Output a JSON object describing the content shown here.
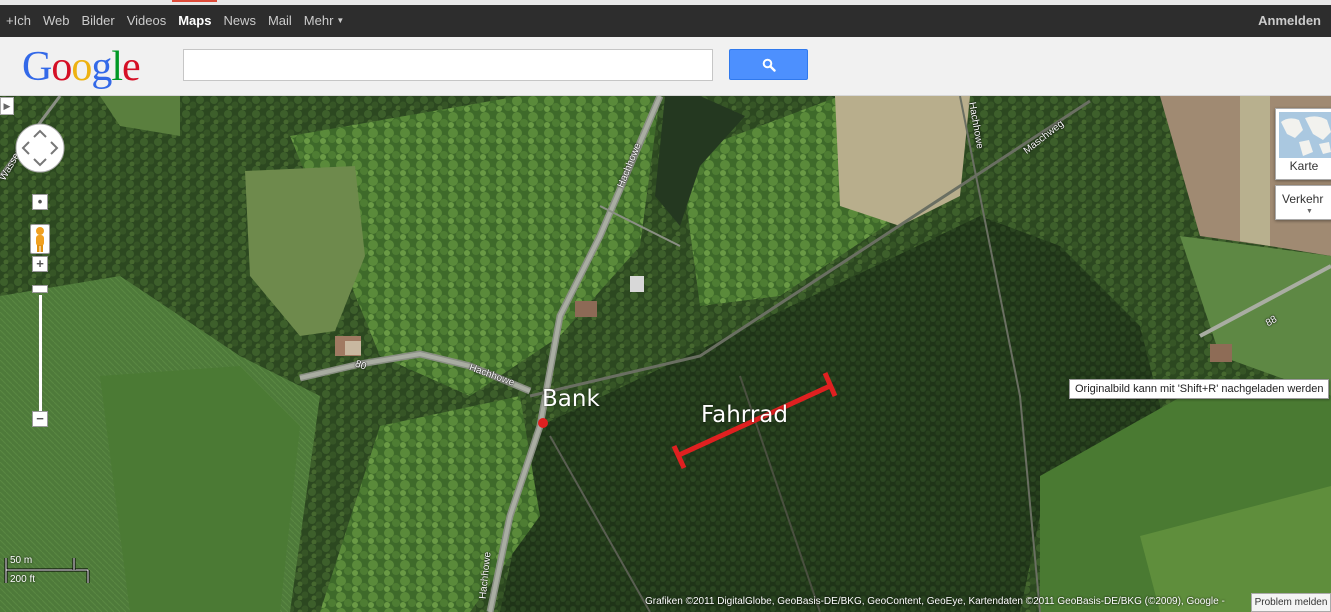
{
  "gbar": {
    "links": [
      "+Ich",
      "Web",
      "Bilder",
      "Videos",
      "Maps",
      "News",
      "Mail",
      "Mehr"
    ],
    "active": "Maps",
    "signin": "Anmelden"
  },
  "logo": {
    "letters": [
      "G",
      "o",
      "o",
      "g",
      "l",
      "e"
    ],
    "colors": [
      "#3369e8",
      "#d50f25",
      "#eeb211",
      "#3369e8",
      "#009925",
      "#d50f25"
    ]
  },
  "search": {
    "value": "",
    "placeholder": ""
  },
  "map_types": {
    "map_label": "Karte",
    "traffic_label": "Verkehr"
  },
  "tooltip": "Originalbild kann mit 'Shift+R' nachgeladen werden",
  "annotations": {
    "bank": "Bank",
    "fahrrad": "Fahrrad",
    "line_color": "#e02020"
  },
  "streets": {
    "hachhowe_1": "Hachhowe",
    "hachhowe_2": "Hachhowe",
    "hachhowe_3": "Hachhowe",
    "hachhowe_4": "Hachhowe",
    "maschweg": "Maschweg",
    "road_80": "80",
    "road_88": "88",
    "wasser": "Wasser"
  },
  "scale": {
    "metric": "50 m",
    "imperial": "200 ft"
  },
  "copyright": "Grafiken ©2011 DigitalGlobe, GeoBasis-DE/BKG, GeoContent, GeoEye, Kartendaten ©2011 GeoBasis-DE/BKG (©2009), Google -",
  "problem_button": "Problem melden",
  "colors": {
    "bar_bg": "#2d2d2d",
    "search_btn": "#4d90fe",
    "active_tab_line": "#dd4b39"
  }
}
